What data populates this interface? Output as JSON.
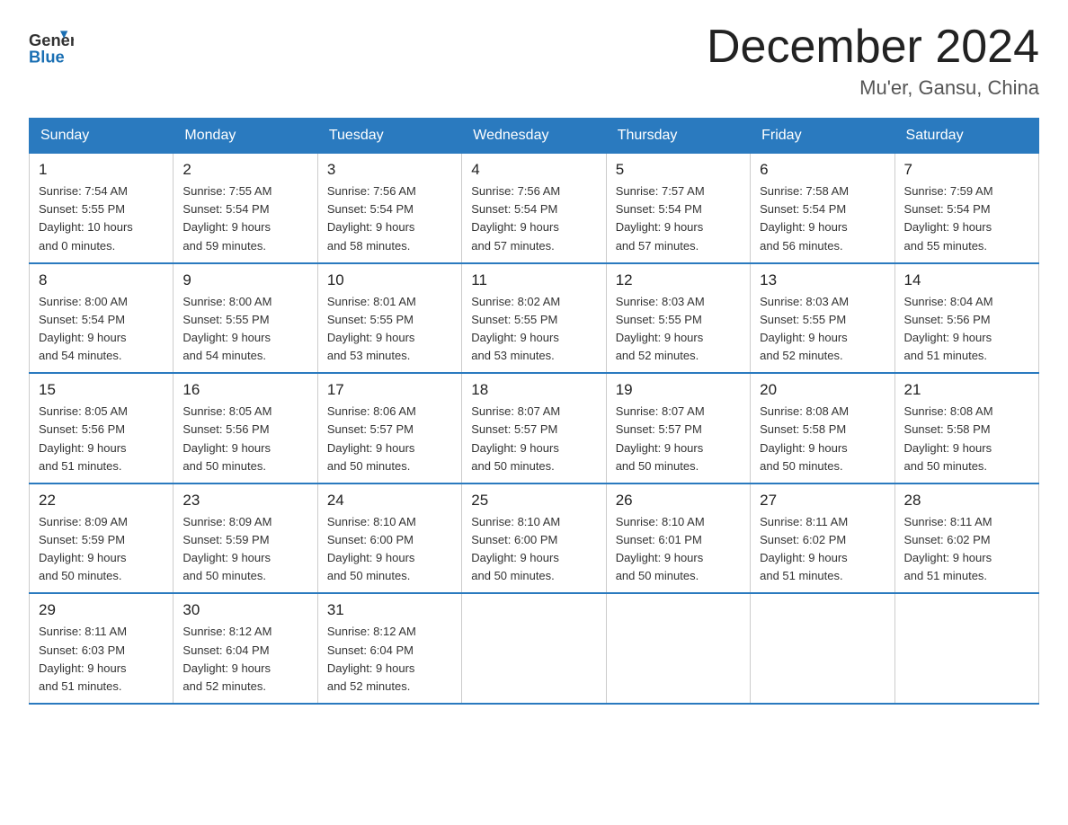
{
  "header": {
    "logo_general": "General",
    "logo_blue": "Blue",
    "title": "December 2024",
    "subtitle": "Mu'er, Gansu, China"
  },
  "days_of_week": [
    "Sunday",
    "Monday",
    "Tuesday",
    "Wednesday",
    "Thursday",
    "Friday",
    "Saturday"
  ],
  "weeks": [
    [
      {
        "day": "1",
        "sunrise": "7:54 AM",
        "sunset": "5:55 PM",
        "daylight": "10 hours and 0 minutes."
      },
      {
        "day": "2",
        "sunrise": "7:55 AM",
        "sunset": "5:54 PM",
        "daylight": "9 hours and 59 minutes."
      },
      {
        "day": "3",
        "sunrise": "7:56 AM",
        "sunset": "5:54 PM",
        "daylight": "9 hours and 58 minutes."
      },
      {
        "day": "4",
        "sunrise": "7:56 AM",
        "sunset": "5:54 PM",
        "daylight": "9 hours and 57 minutes."
      },
      {
        "day": "5",
        "sunrise": "7:57 AM",
        "sunset": "5:54 PM",
        "daylight": "9 hours and 57 minutes."
      },
      {
        "day": "6",
        "sunrise": "7:58 AM",
        "sunset": "5:54 PM",
        "daylight": "9 hours and 56 minutes."
      },
      {
        "day": "7",
        "sunrise": "7:59 AM",
        "sunset": "5:54 PM",
        "daylight": "9 hours and 55 minutes."
      }
    ],
    [
      {
        "day": "8",
        "sunrise": "8:00 AM",
        "sunset": "5:54 PM",
        "daylight": "9 hours and 54 minutes."
      },
      {
        "day": "9",
        "sunrise": "8:00 AM",
        "sunset": "5:55 PM",
        "daylight": "9 hours and 54 minutes."
      },
      {
        "day": "10",
        "sunrise": "8:01 AM",
        "sunset": "5:55 PM",
        "daylight": "9 hours and 53 minutes."
      },
      {
        "day": "11",
        "sunrise": "8:02 AM",
        "sunset": "5:55 PM",
        "daylight": "9 hours and 53 minutes."
      },
      {
        "day": "12",
        "sunrise": "8:03 AM",
        "sunset": "5:55 PM",
        "daylight": "9 hours and 52 minutes."
      },
      {
        "day": "13",
        "sunrise": "8:03 AM",
        "sunset": "5:55 PM",
        "daylight": "9 hours and 52 minutes."
      },
      {
        "day": "14",
        "sunrise": "8:04 AM",
        "sunset": "5:56 PM",
        "daylight": "9 hours and 51 minutes."
      }
    ],
    [
      {
        "day": "15",
        "sunrise": "8:05 AM",
        "sunset": "5:56 PM",
        "daylight": "9 hours and 51 minutes."
      },
      {
        "day": "16",
        "sunrise": "8:05 AM",
        "sunset": "5:56 PM",
        "daylight": "9 hours and 50 minutes."
      },
      {
        "day": "17",
        "sunrise": "8:06 AM",
        "sunset": "5:57 PM",
        "daylight": "9 hours and 50 minutes."
      },
      {
        "day": "18",
        "sunrise": "8:07 AM",
        "sunset": "5:57 PM",
        "daylight": "9 hours and 50 minutes."
      },
      {
        "day": "19",
        "sunrise": "8:07 AM",
        "sunset": "5:57 PM",
        "daylight": "9 hours and 50 minutes."
      },
      {
        "day": "20",
        "sunrise": "8:08 AM",
        "sunset": "5:58 PM",
        "daylight": "9 hours and 50 minutes."
      },
      {
        "day": "21",
        "sunrise": "8:08 AM",
        "sunset": "5:58 PM",
        "daylight": "9 hours and 50 minutes."
      }
    ],
    [
      {
        "day": "22",
        "sunrise": "8:09 AM",
        "sunset": "5:59 PM",
        "daylight": "9 hours and 50 minutes."
      },
      {
        "day": "23",
        "sunrise": "8:09 AM",
        "sunset": "5:59 PM",
        "daylight": "9 hours and 50 minutes."
      },
      {
        "day": "24",
        "sunrise": "8:10 AM",
        "sunset": "6:00 PM",
        "daylight": "9 hours and 50 minutes."
      },
      {
        "day": "25",
        "sunrise": "8:10 AM",
        "sunset": "6:00 PM",
        "daylight": "9 hours and 50 minutes."
      },
      {
        "day": "26",
        "sunrise": "8:10 AM",
        "sunset": "6:01 PM",
        "daylight": "9 hours and 50 minutes."
      },
      {
        "day": "27",
        "sunrise": "8:11 AM",
        "sunset": "6:02 PM",
        "daylight": "9 hours and 51 minutes."
      },
      {
        "day": "28",
        "sunrise": "8:11 AM",
        "sunset": "6:02 PM",
        "daylight": "9 hours and 51 minutes."
      }
    ],
    [
      {
        "day": "29",
        "sunrise": "8:11 AM",
        "sunset": "6:03 PM",
        "daylight": "9 hours and 51 minutes."
      },
      {
        "day": "30",
        "sunrise": "8:12 AM",
        "sunset": "6:04 PM",
        "daylight": "9 hours and 52 minutes."
      },
      {
        "day": "31",
        "sunrise": "8:12 AM",
        "sunset": "6:04 PM",
        "daylight": "9 hours and 52 minutes."
      },
      null,
      null,
      null,
      null
    ]
  ],
  "labels": {
    "sunrise": "Sunrise:",
    "sunset": "Sunset:",
    "daylight": "Daylight:"
  }
}
